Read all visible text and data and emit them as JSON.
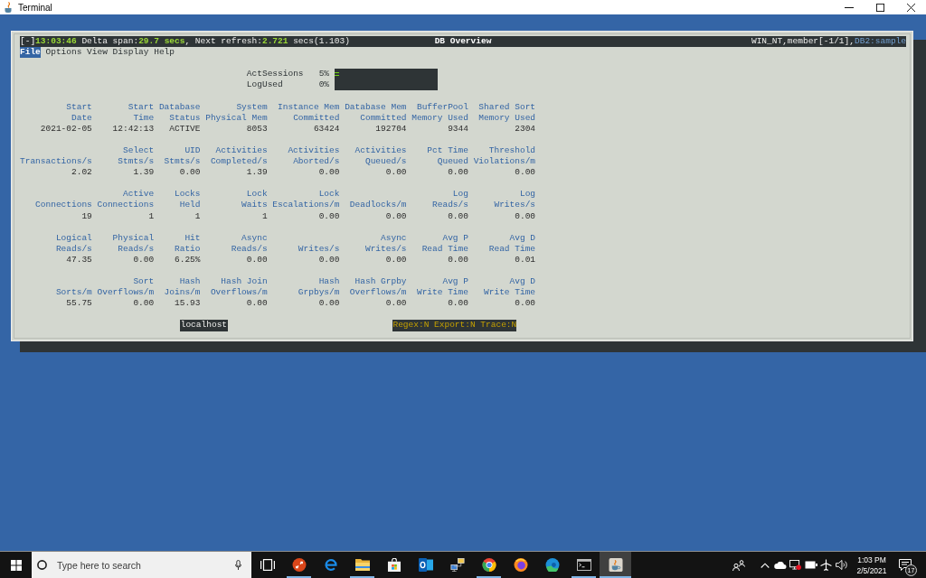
{
  "window": {
    "title": "Terminal"
  },
  "terminal": {
    "status_bar": {
      "toggle": "[-]",
      "time": "13:03:46",
      "stats": [
        {
          "label": "Delta span:",
          "value": "29.7 secs"
        },
        {
          "label": ", Next refresh:",
          "value": "2.721"
        }
      ],
      "note": "secs(1.103)",
      "title": "DB Overview",
      "context": "WIN_NT,member[-1/1],",
      "database": "DB2:sample"
    },
    "menu": [
      {
        "label": "File",
        "selected": true
      },
      {
        "label": "Options",
        "selected": false
      },
      {
        "label": "View",
        "selected": false
      },
      {
        "label": "Display",
        "selected": false
      },
      {
        "label": "Help",
        "selected": false
      }
    ],
    "gauges": [
      {
        "label": "ActSessions",
        "reading": "5%",
        "level": 0.05
      },
      {
        "label": "LogUsed",
        "reading": "0%"
      }
    ],
    "metric_groups": [
      {
        "columns": [
          {
            "header": [
              "Start",
              "Date"
            ],
            "value": "2021-02-05"
          },
          {
            "header": [
              "Start",
              "Time"
            ],
            "value": "12:42:13"
          },
          {
            "header": [
              "Database",
              "Status"
            ],
            "value": "ACTIVE"
          },
          {
            "header": [
              "System",
              "Physical Mem"
            ],
            "value": "8053"
          },
          {
            "header": [
              "Instance Mem",
              "Committed"
            ],
            "value": "63424"
          },
          {
            "header": [
              "Database Mem",
              "Committed"
            ],
            "value": "192704"
          },
          {
            "header": [
              "BufferPool",
              "Memory Used"
            ],
            "value": "9344"
          },
          {
            "header": [
              "Shared Sort",
              "Memory Used"
            ],
            "value": "2304"
          }
        ]
      },
      {
        "columns": [
          {
            "header": [
              "Transactions/s"
            ],
            "value": "2.02"
          },
          {
            "header": [
              "Select",
              "Stmts/s"
            ],
            "value": "1.39"
          },
          {
            "header": [
              "UID",
              "Stmts/s"
            ],
            "value": "0.00"
          },
          {
            "header": [
              "Activities",
              "Completed/s"
            ],
            "value": "1.39"
          },
          {
            "header": [
              "Activities",
              "Aborted/s"
            ],
            "value": "0.00"
          },
          {
            "header": [
              "Activities",
              "Queued/s"
            ],
            "value": "0.00"
          },
          {
            "header": [
              "Pct Time",
              "Queued"
            ],
            "value": "0.00"
          },
          {
            "header": [
              "Threshold",
              "Violations/m"
            ],
            "value": "0.00"
          }
        ]
      },
      {
        "columns": [
          {
            "header": [
              "Connections"
            ],
            "value": "19"
          },
          {
            "header": [
              "Active",
              "Connections"
            ],
            "value": "1"
          },
          {
            "header": [
              "Locks",
              "Held"
            ],
            "value": "1"
          },
          {
            "header": [
              "Lock",
              "Waits"
            ],
            "value": "1"
          },
          {
            "header": [
              "Lock",
              "Escalations/m"
            ],
            "value": "0.00"
          },
          {
            "header": [
              "Deadlocks/m"
            ],
            "value": "0.00"
          },
          {
            "header": [
              "Log",
              "Reads/s"
            ],
            "value": "0.00"
          },
          {
            "header": [
              "Log",
              "Writes/s"
            ],
            "value": "0.00"
          }
        ]
      },
      {
        "columns": [
          {
            "header": [
              "Logical",
              "Reads/s"
            ],
            "value": "47.35"
          },
          {
            "header": [
              "Physical",
              "Reads/s"
            ],
            "value": "0.00"
          },
          {
            "header": [
              "Hit",
              "Ratio"
            ],
            "value": "6.25%"
          },
          {
            "header": [
              "Async",
              "Reads/s"
            ],
            "value": "0.00"
          },
          {
            "header": [
              "Writes/s"
            ],
            "value": "0.00"
          },
          {
            "header": [
              "Async",
              "Writes/s"
            ],
            "value": "0.00"
          },
          {
            "header": [
              "Avg P",
              "Read Time"
            ],
            "value": "0.00"
          },
          {
            "header": [
              "Avg D",
              "Read Time"
            ],
            "value": "0.01"
          }
        ]
      },
      {
        "columns": [
          {
            "header": [
              "Sorts/m"
            ],
            "value": "55.75"
          },
          {
            "header": [
              "Sort",
              "Overflows/m"
            ],
            "value": "0.00"
          },
          {
            "header": [
              "Hash",
              "Joins/m"
            ],
            "value": "15.93"
          },
          {
            "header": [
              "Hash Join",
              "Overflows/m"
            ],
            "value": "0.00"
          },
          {
            "header": [
              "Hash",
              "Grpbys/m"
            ],
            "value": "0.00"
          },
          {
            "header": [
              "Hash Grpby",
              "Overflows/m"
            ],
            "value": "0.00"
          },
          {
            "header": [
              "Avg P",
              "Write Time"
            ],
            "value": "0.00"
          },
          {
            "header": [
              "Avg D",
              "Write Time"
            ],
            "value": "0.00"
          }
        ]
      }
    ],
    "footer": {
      "host": "localhost",
      "flags": "Regex:N Export:N Trace:N"
    }
  },
  "taskbar": {
    "search": {
      "placeholder": "Type here to search"
    },
    "apps": [
      {
        "kind": "task-view",
        "running": false,
        "active": false
      },
      {
        "kind": "disc-arrows",
        "running": true,
        "active": false
      },
      {
        "kind": "arc",
        "running": false,
        "active": false
      },
      {
        "kind": "folder",
        "running": true,
        "active": false
      },
      {
        "kind": "bag",
        "running": false,
        "active": false
      },
      {
        "kind": "mail",
        "running": false,
        "active": false
      },
      {
        "kind": "network",
        "running": false,
        "active": false
      },
      {
        "kind": "ring",
        "running": true,
        "active": false
      },
      {
        "kind": "globe",
        "running": false,
        "active": false
      },
      {
        "kind": "wave",
        "running": false,
        "active": false
      },
      {
        "kind": "console",
        "running": true,
        "active": false
      },
      {
        "kind": "cup",
        "running": true,
        "active": true
      }
    ],
    "clock": {
      "time": "1:03 PM",
      "date": "2/5/2021"
    },
    "notifications": {
      "count": "17"
    }
  }
}
